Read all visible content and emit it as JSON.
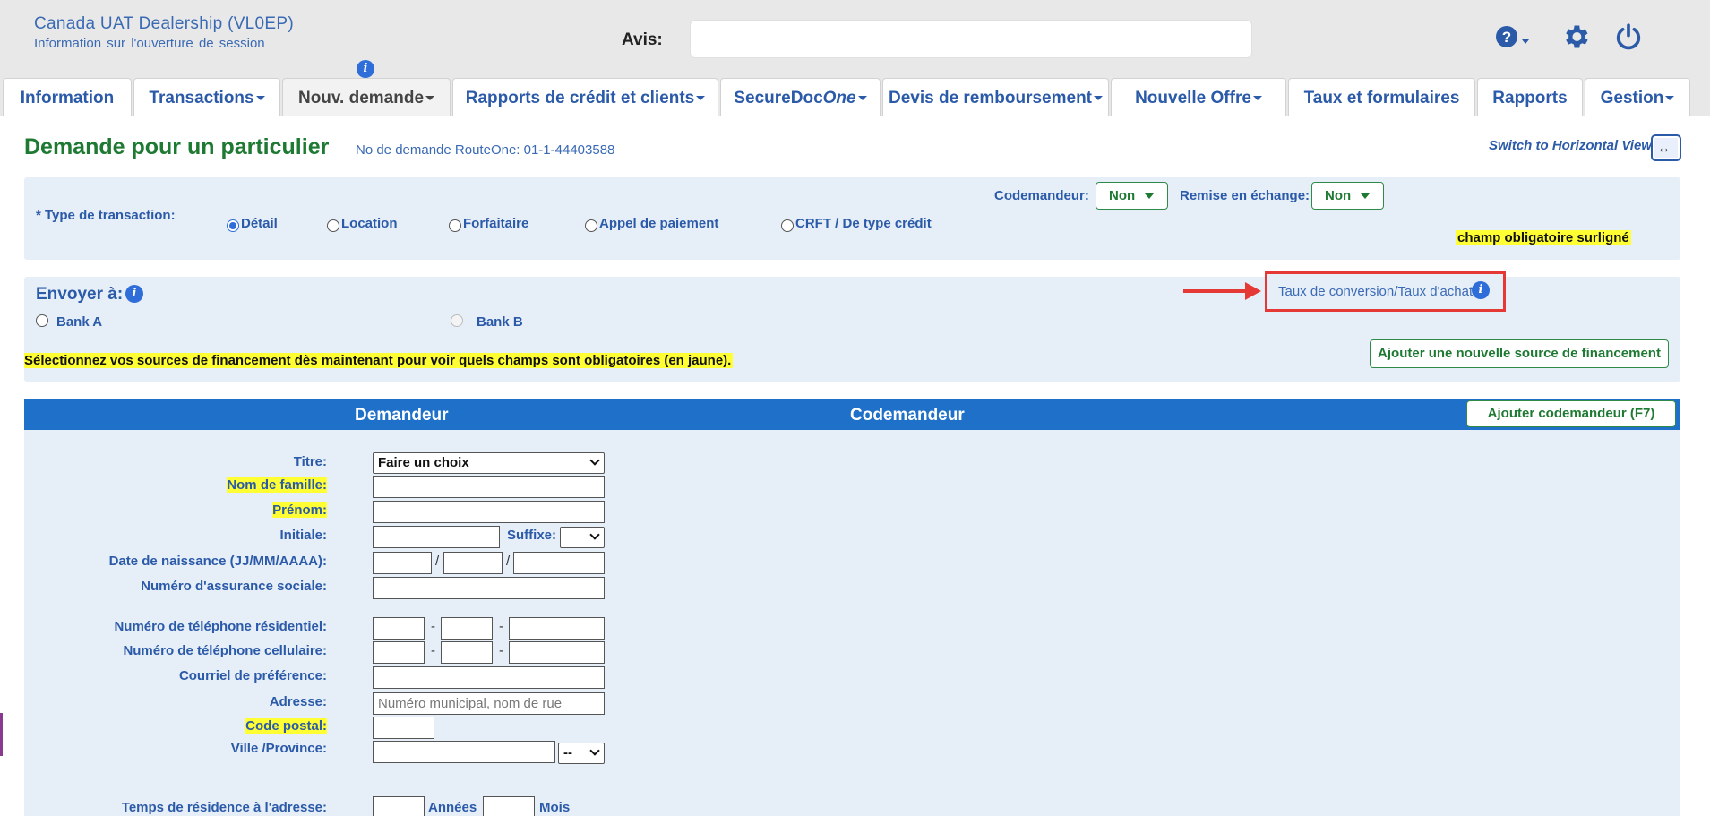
{
  "header": {
    "dealer_name": "Canada UAT Dealership (VL0EP)",
    "login_info": "Information sur l'ouverture de session",
    "notice_label": "Avis:",
    "info_dot": "i"
  },
  "tabs": [
    {
      "label": "Information",
      "dropdown": false
    },
    {
      "label": "Transactions",
      "dropdown": true
    },
    {
      "label": "Nouv. demande",
      "dropdown": true,
      "active": true
    },
    {
      "label": "Rapports de crédit et clients",
      "dropdown": true
    },
    {
      "label_main": "SecureDoc",
      "label_italic": "One",
      "dropdown": true
    },
    {
      "label": "Devis de remboursement",
      "dropdown": true
    },
    {
      "label": "Nouvelle Offre",
      "dropdown": true
    },
    {
      "label": "Taux et formulaires",
      "dropdown": false
    },
    {
      "label": "Rapports",
      "dropdown": false
    },
    {
      "label": "Gestion",
      "dropdown": true
    }
  ],
  "page": {
    "title": "Demande pour un particulier",
    "request_no": "No de demande RouteOne: 01-1-44403588",
    "switch_view": "Switch to Horizontal View",
    "switch_glyph": "↔"
  },
  "transaction": {
    "label": "* Type de transaction:",
    "options": [
      "Détail",
      "Location",
      "Forfaitaire",
      "Appel de paiement",
      "CRFT / De type crédit"
    ],
    "selected": "Détail",
    "coapplicant_label": "Codemandeur:",
    "coapplicant_value": "Non",
    "tradein_label": "Remise en échange:",
    "tradein_value": "Non",
    "required_note": "champ obligatoire surligné"
  },
  "send_to": {
    "label": "Envoyer à:",
    "bank_a": "Bank A",
    "bank_b": "Bank B",
    "conversion_rate": "Taux de conversion/Taux d'achat",
    "note": "Sélectionnez vos sources de financement dès maintenant pour voir quels champs sont obligatoires (en jaune).",
    "add_source": "Ajouter une nouvelle source de financement"
  },
  "applicant": {
    "applicant_title": "Demandeur",
    "coapplicant_title": "Codemandeur",
    "add_coapplicant": "Ajouter codemandeur  (F7)",
    "labels": {
      "title": "Titre:",
      "last_name": "Nom de famille:",
      "first_name": "Prénom:",
      "initial": "Initiale:",
      "suffix": "Suffixe:",
      "dob": "Date de naissance (JJ/MM/AAAA):",
      "sin": "Numéro d'assurance sociale:",
      "home_phone": "Numéro de téléphone résidentiel:",
      "cell_phone": "Numéro de téléphone cellulaire:",
      "email": "Courriel de préférence:",
      "address": "Adresse:",
      "postal": "Code postal:",
      "city": "Ville /Province:",
      "residence_time": "Temps de résidence à l'adresse:"
    },
    "title_value": "Faire un choix",
    "address_placeholder": "Numéro municipal, nom de rue",
    "province_value": "--",
    "date_sep": "/",
    "phone_sep": "-",
    "years": "Années",
    "months": "Mois"
  }
}
